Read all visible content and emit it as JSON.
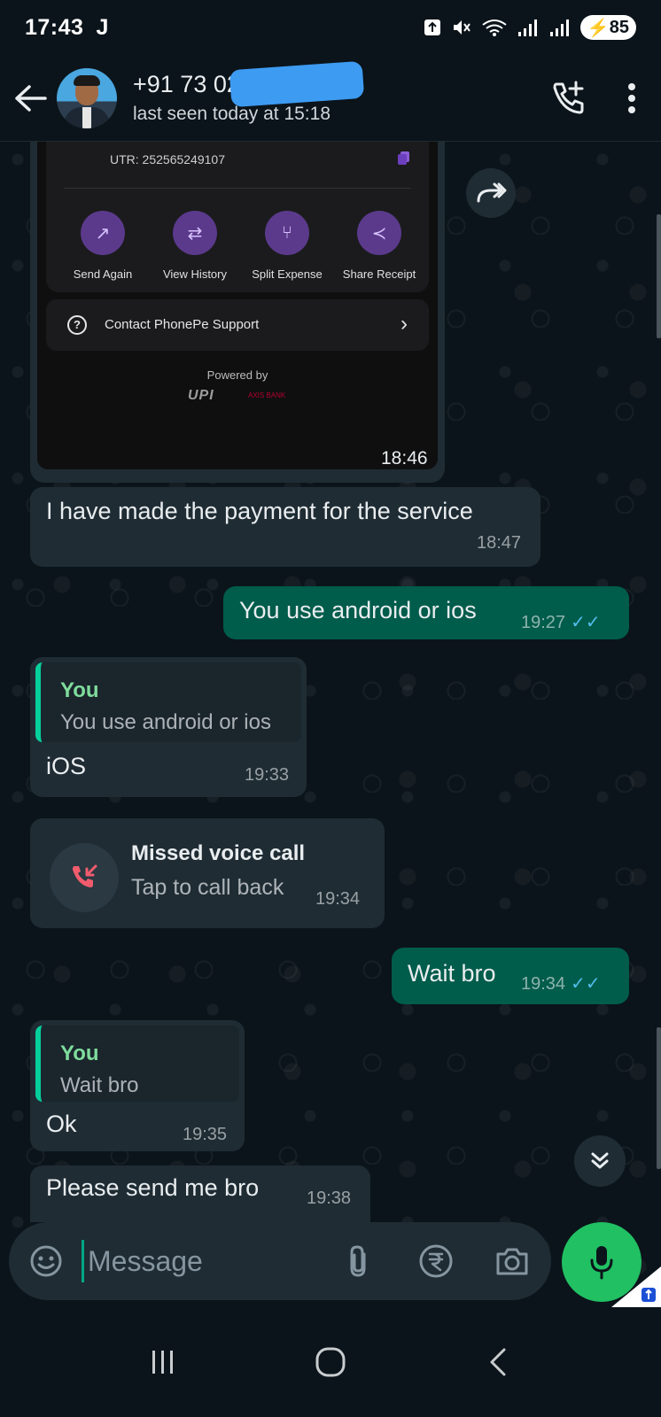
{
  "status_bar": {
    "time": "17:43",
    "app_indicator": "J",
    "battery": "85"
  },
  "header": {
    "contact_name": "+91 73        029",
    "last_seen": "last seen today at 15:18"
  },
  "receipt": {
    "utr": "UTR: 252565249107",
    "actions": [
      {
        "label": "Send Again"
      },
      {
        "label": "View History"
      },
      {
        "label": "Split Expense"
      },
      {
        "label": "Share Receipt"
      }
    ],
    "support": "Contact PhonePe Support",
    "powered_by": "Powered by",
    "upi": "UPI",
    "bank": "AXIS BANK",
    "time": "18:46"
  },
  "messages": [
    {
      "text": "I have made the payment for the service",
      "time": "18:47"
    },
    {
      "text": "You use android or ios",
      "time": "19:27"
    },
    {
      "quote_who": "You",
      "quote_text": "You use android or ios",
      "text": "iOS",
      "time": "19:33"
    },
    {
      "title": "Missed voice call",
      "subtitle": "Tap to call back",
      "time": "19:34"
    },
    {
      "text": "Wait bro",
      "time": "19:34"
    },
    {
      "quote_who": "You",
      "quote_text": "Wait bro",
      "text": "Ok",
      "time": "19:35"
    },
    {
      "text": "Please send me bro",
      "time": "19:38"
    }
  ],
  "input": {
    "placeholder": "Message"
  },
  "colors": {
    "background": "#0b141a",
    "incoming_bubble": "#1f2c34",
    "outgoing_bubble": "#005c4b",
    "accent_green": "#21c063",
    "read_ticks": "#53bdeb"
  }
}
